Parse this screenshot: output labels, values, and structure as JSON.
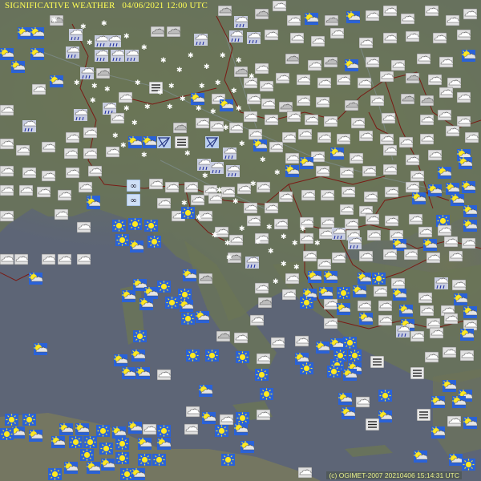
{
  "map": {
    "title": "SIGNIFICATIVE WEATHER",
    "datetime": "04/06/2021 12:00 UTC",
    "credit": "(c) OGIMET-2007 20210406 15:14:31 UTC"
  },
  "legend_colors": {
    "land": "#6b7656",
    "sea": "#5d6576",
    "borders": "#7a1a14",
    "title_text": "#ffff55",
    "icon_frame": "#2a62d8",
    "sun": "#ffe820",
    "cloud": "#c8c8c8"
  },
  "icon_types": [
    "partly-cloudy-icon",
    "sunny-icon",
    "overcast-icon",
    "cloudy-icon",
    "rain-icon",
    "snow-shower-icon",
    "shower-icon",
    "haze-icon",
    "fog-icon",
    "thunderstorm-icon",
    "snow-icon"
  ]
}
